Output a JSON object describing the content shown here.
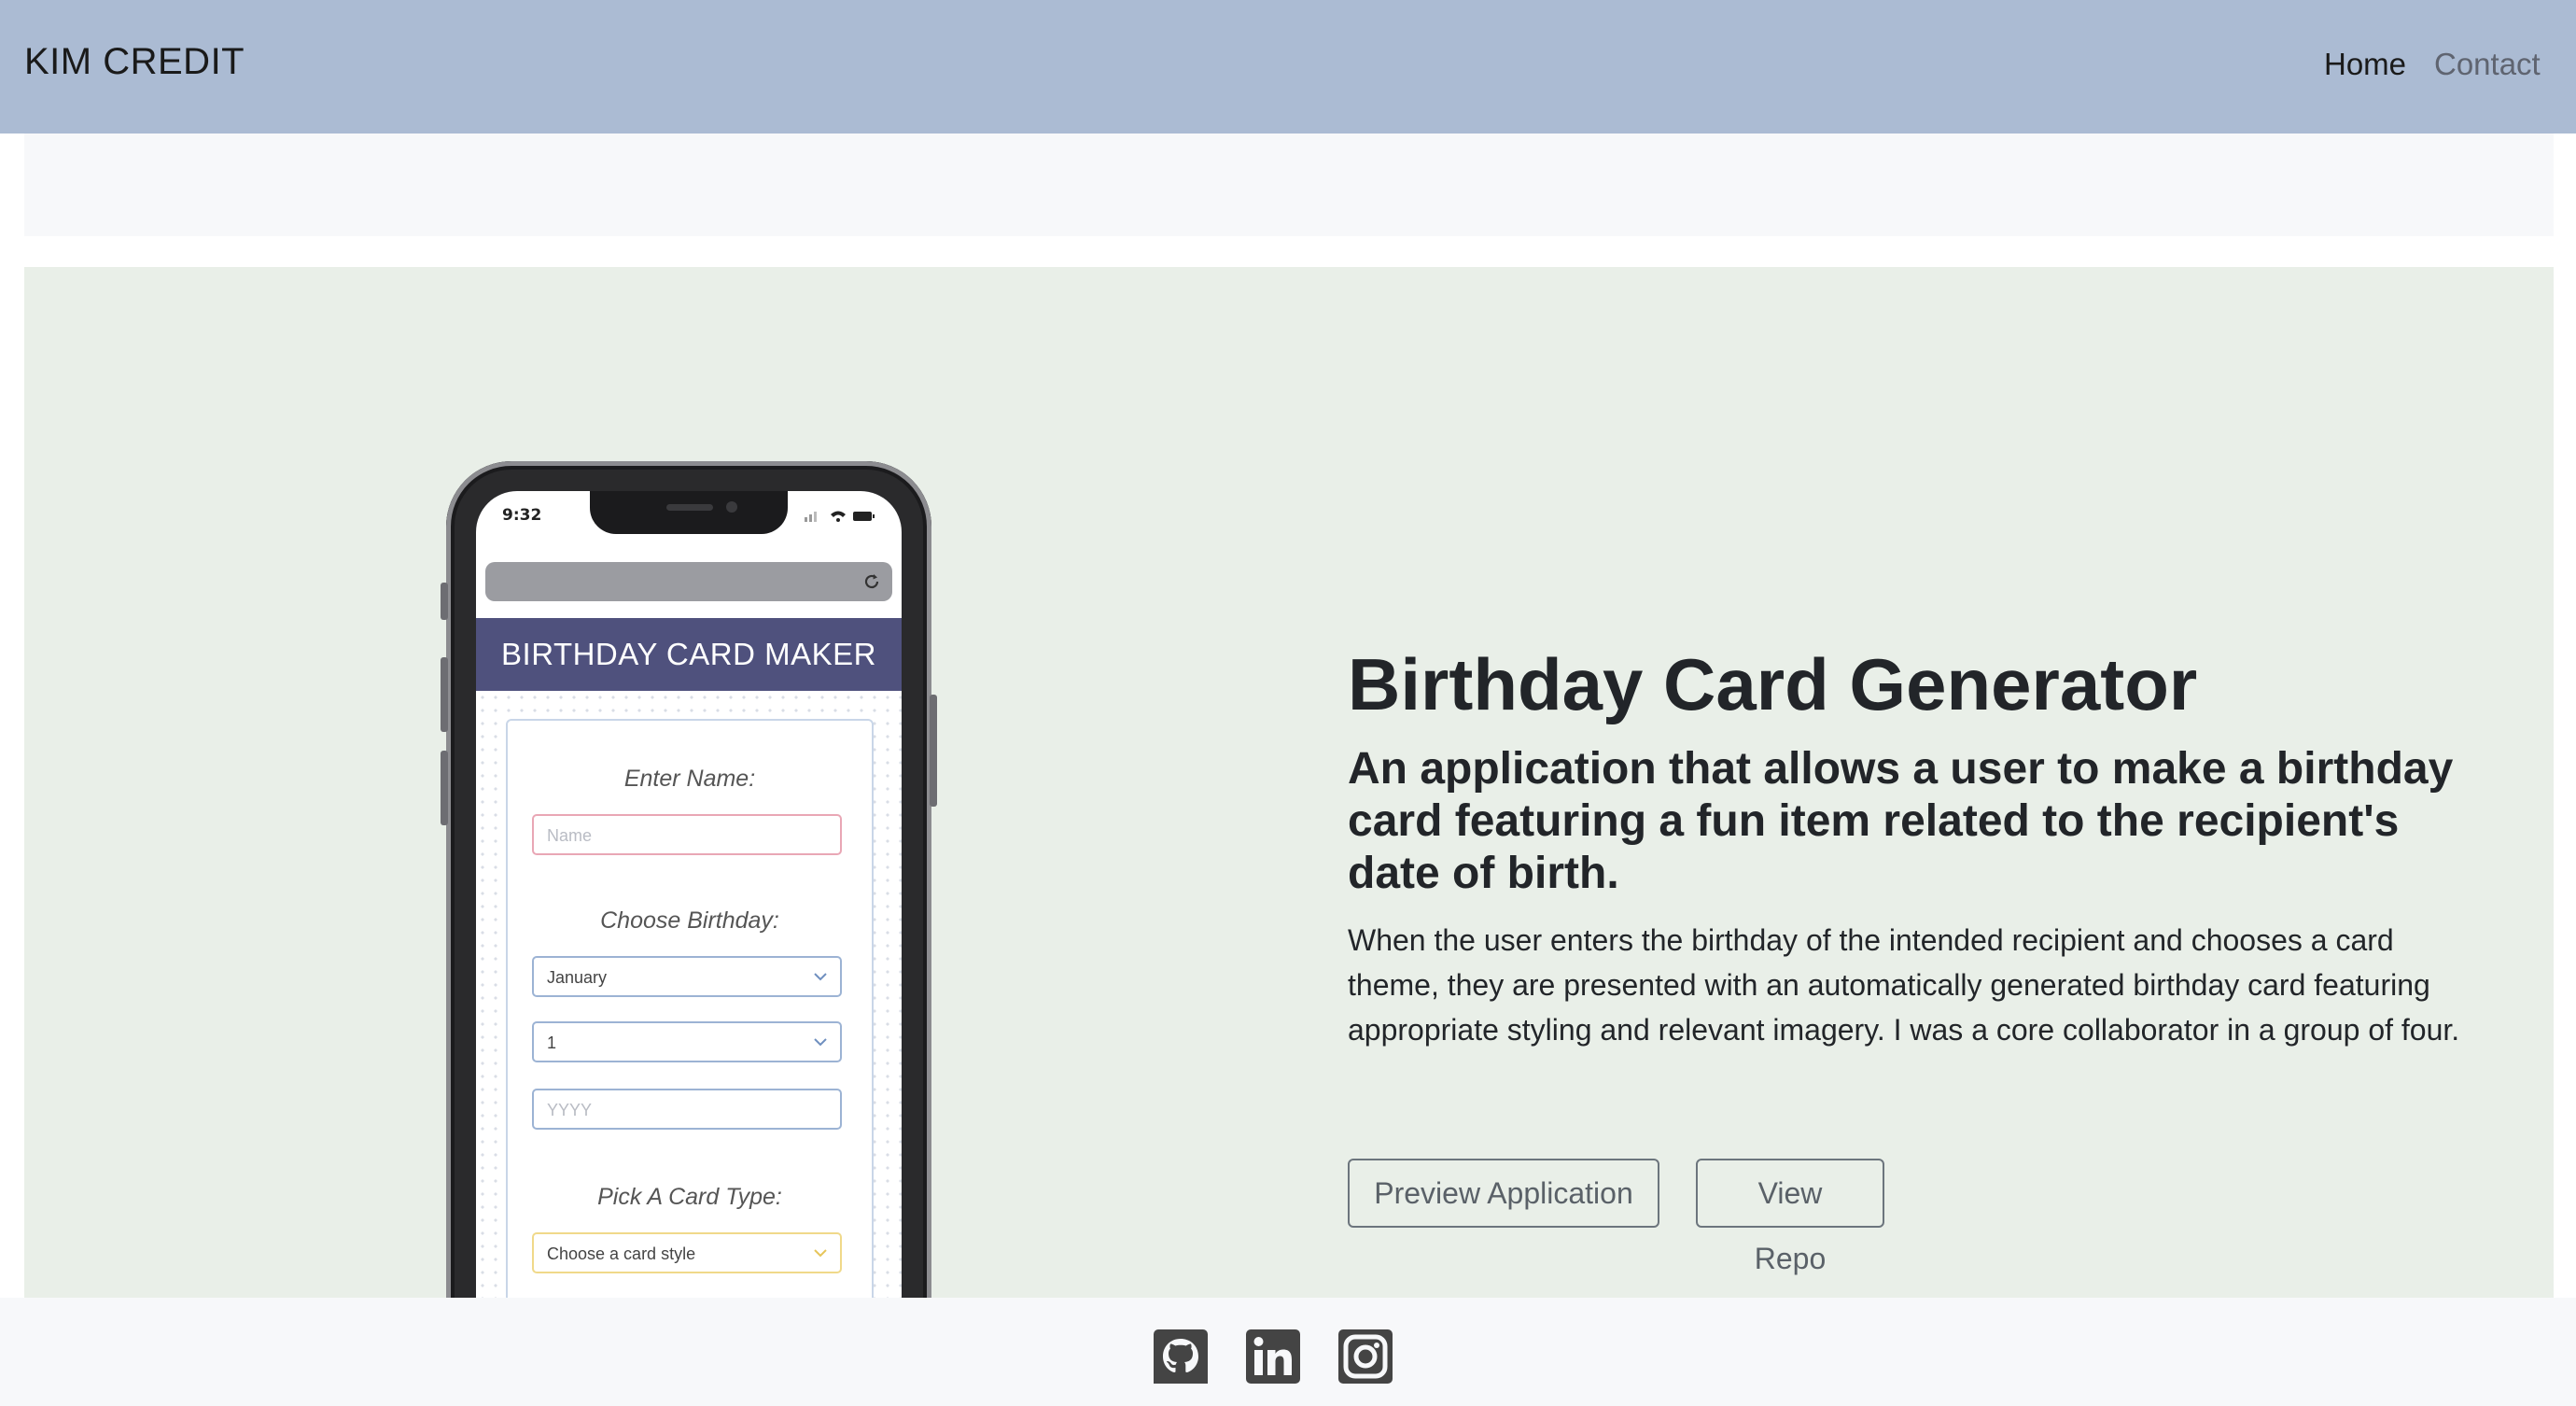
{
  "navbar": {
    "brand": "KIM CREDIT",
    "links": [
      {
        "label": "Home",
        "active": true
      },
      {
        "label": "Contact",
        "active": false
      }
    ]
  },
  "project": {
    "title": "Birthday Card Generator",
    "subtitle": "An application that allows a user to make a birthday card featuring a fun item related to the recipient's date of birth.",
    "description": "When the user enters the birthday of the intended recipient and chooses a card theme, they are presented with an automatically generated birthday card featuring appropriate styling and relevant imagery. I was a core collaborator in a group of four.",
    "buttons": {
      "preview": "Preview Application",
      "repo": "View Repo"
    },
    "mockup": {
      "status_time": "9:32",
      "app_title": "BIRTHDAY CARD MAKER",
      "name_label": "Enter Name:",
      "name_placeholder": "Name",
      "birthday_label": "Choose Birthday:",
      "month_value": "January",
      "day_value": "1",
      "year_placeholder": "YYYY",
      "card_label": "Pick A Card Type:",
      "card_value": "Choose a card style"
    }
  },
  "footer": {
    "icons": [
      "github-icon",
      "linkedin-icon",
      "instagram-icon"
    ]
  },
  "colors": {
    "navbar": "#abbbd3",
    "project_bg": "#e9efe8",
    "app_header": "#4f517d",
    "footer_bg": "#f7f8fa"
  }
}
